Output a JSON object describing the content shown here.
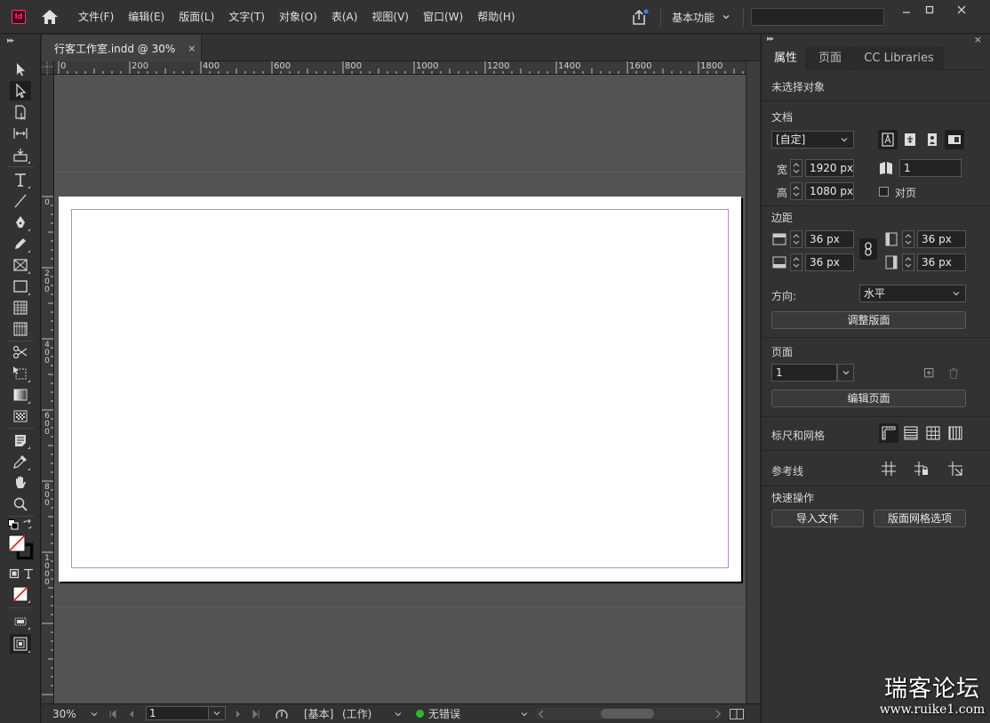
{
  "app": {
    "logo_text": "Id"
  },
  "menu": [
    "文件(F)",
    "编辑(E)",
    "版面(L)",
    "文字(T)",
    "对象(O)",
    "表(A)",
    "视图(V)",
    "窗口(W)",
    "帮助(H)"
  ],
  "workspace": "基本功能",
  "document": {
    "tab_title": "行客工作室.indd @ 30%",
    "close": "×"
  },
  "ruler_h": [
    "0",
    "200",
    "400",
    "600",
    "800",
    "1000",
    "1200",
    "1400",
    "1600",
    "1800"
  ],
  "ruler_v": [
    "0",
    "200",
    "400",
    "600",
    "800",
    "1000"
  ],
  "status": {
    "zoom": "30%",
    "page": "1",
    "master": "[基本]",
    "profile": "(工作)",
    "preflight": "无错误"
  },
  "panel": {
    "tabs": [
      "属性",
      "页面",
      "CC Libraries"
    ],
    "selection": "未选择对象",
    "doc_section": "文档",
    "preset": "[自定]",
    "width_label": "宽",
    "width": "1920 px",
    "height_label": "高",
    "height": "1080 px",
    "pages": "1",
    "facing": "对页",
    "margins_section": "边距",
    "margin_top": "36 px",
    "margin_bottom": "36 px",
    "margin_left": "36 px",
    "margin_right": "36 px",
    "orientation_label": "方向:",
    "orientation": "水平",
    "adjust_layout": "调整版面",
    "page_section": "页面",
    "page_select": "1",
    "edit_page": "编辑页面",
    "rulers_grids": "标尺和网格",
    "guides": "参考线",
    "quick_actions": "快速操作",
    "import_file": "导入文件",
    "layout_grid": "版面网格选项"
  },
  "watermark": {
    "title": "瑞客论坛",
    "url": "www.ruike1.com"
  },
  "colors": {
    "accent_logo": "#ff3366",
    "margin_guide": "#b48ad8",
    "status_ok": "#2eb82e"
  }
}
